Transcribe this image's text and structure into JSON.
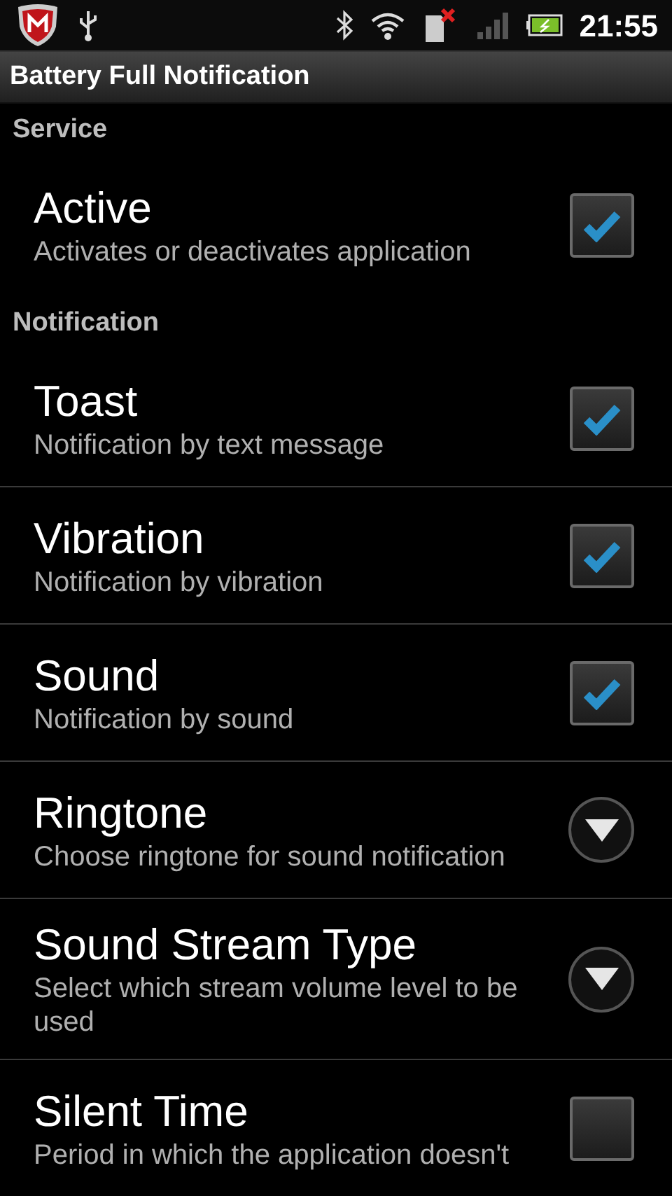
{
  "status_bar": {
    "time": "21:55"
  },
  "window": {
    "title": "Battery Full Notification"
  },
  "sections": [
    {
      "header": "Service",
      "items": [
        {
          "kind": "checkbox",
          "title": "Active",
          "summary": "Activates or deactivates application",
          "checked": true
        }
      ]
    },
    {
      "header": "Notification",
      "items": [
        {
          "kind": "checkbox",
          "title": "Toast",
          "summary": "Notification by text message",
          "checked": true
        },
        {
          "kind": "checkbox",
          "title": "Vibration",
          "summary": "Notification by vibration",
          "checked": true
        },
        {
          "kind": "checkbox",
          "title": "Sound",
          "summary": "Notification by sound",
          "checked": true
        },
        {
          "kind": "dropdown",
          "title": "Ringtone",
          "summary": "Choose ringtone for sound notification"
        },
        {
          "kind": "dropdown",
          "title": "Sound Stream Type",
          "summary": "Select which stream volume level to be used"
        },
        {
          "kind": "checkbox",
          "title": "Silent Time",
          "summary": "Period in which the application doesn't",
          "checked": false
        }
      ]
    }
  ]
}
